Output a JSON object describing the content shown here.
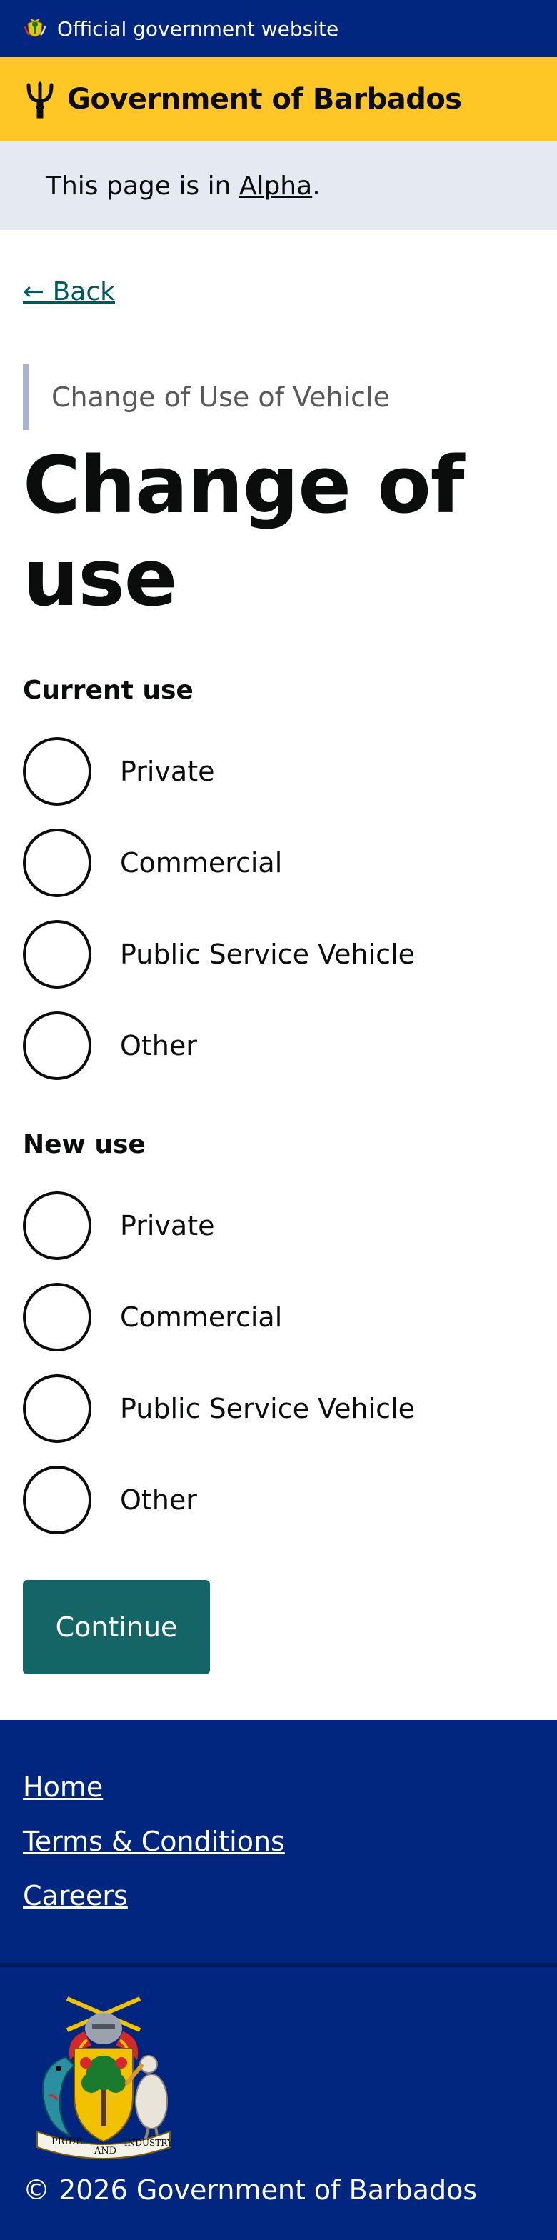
{
  "banner": {
    "official_text": "Official government website",
    "crest_icon": "barbados-crest-icon"
  },
  "brand": {
    "title": "Government of Barbados",
    "logo_icon": "trident-icon",
    "color": "#ffc726"
  },
  "phase_banner": {
    "prefix": "This page is in ",
    "phase_link": "Alpha",
    "suffix": "."
  },
  "back_link": "← Back",
  "caption": "Change of Use of Vehicle",
  "heading_line1": "Change of",
  "heading_line2": "use",
  "current_use": {
    "legend": "Current use",
    "options": [
      "Private",
      "Commercial",
      "Public Service Vehicle",
      "Other"
    ]
  },
  "new_use": {
    "legend": "New use",
    "options": [
      "Private",
      "Commercial",
      "Public Service Vehicle",
      "Other"
    ]
  },
  "continue_label": "Continue",
  "footer": {
    "links": [
      "Home",
      "Terms & Conditions",
      "Careers"
    ],
    "coat_of_arms_icon": "coat-of-arms-icon",
    "coat_motto_left": "PRIDE",
    "coat_motto_mid": "AND",
    "coat_motto_right": "INDUSTRY",
    "copyright": "© 2026 Government of Barbados"
  },
  "colors": {
    "navy": "#00267f",
    "gold": "#ffc726",
    "teal": "#136566",
    "link": "#005a62"
  }
}
